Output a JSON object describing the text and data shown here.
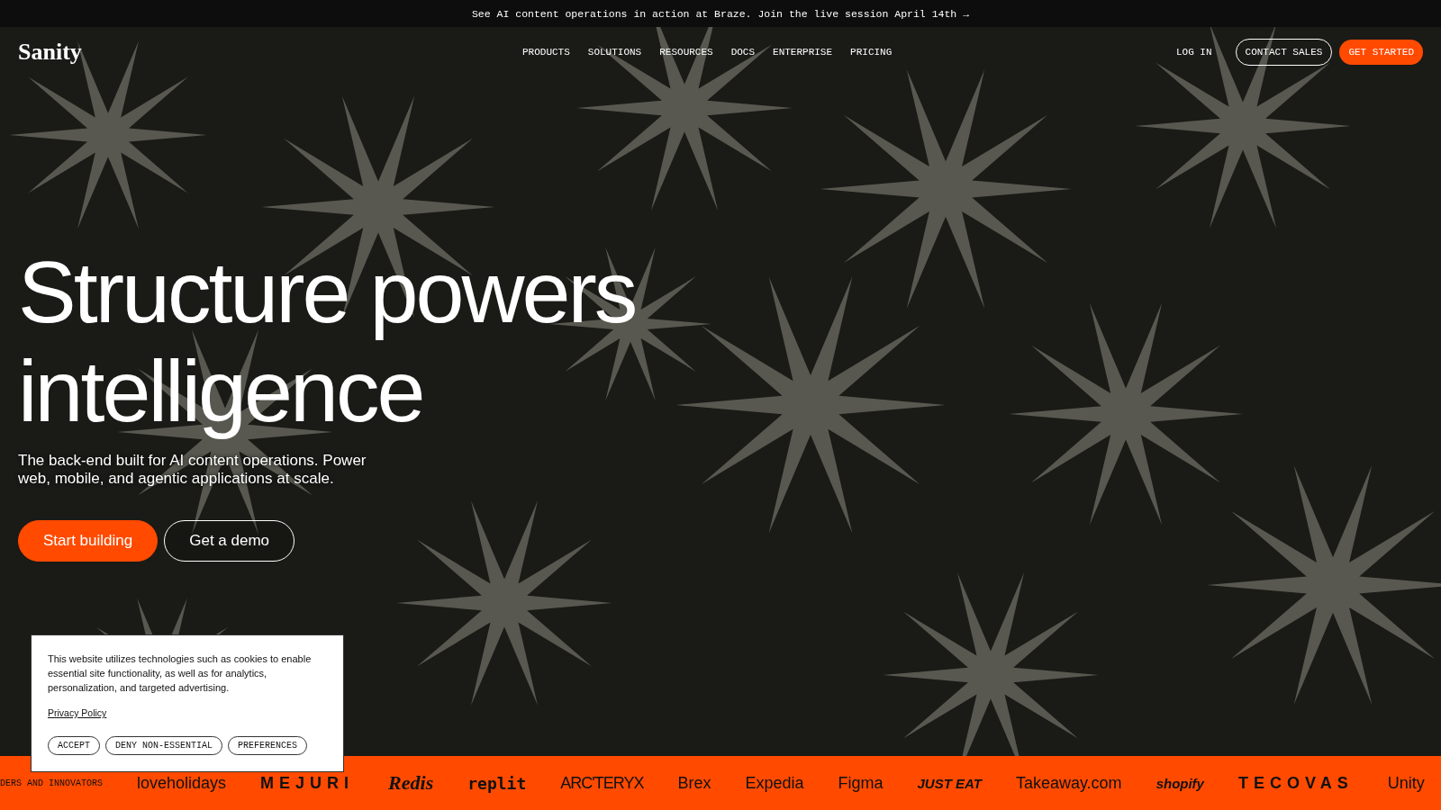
{
  "announcement": {
    "text": "See AI content operations in action at Braze. Join the live session April 14th",
    "arrow": "→"
  },
  "header": {
    "logo": "Sanity",
    "nav": [
      "PRODUCTS",
      "SOLUTIONS",
      "RESOURCES",
      "DOCS",
      "ENTERPRISE",
      "PRICING"
    ],
    "actions": [
      {
        "label": "LOG IN",
        "kind": "link"
      },
      {
        "label": "CONTACT SALES",
        "kind": "outline"
      },
      {
        "label": "GET STARTED",
        "kind": "primary"
      }
    ]
  },
  "hero": {
    "kind": "picture",
    "headline": [
      "Structure powers",
      "intelligence"
    ],
    "subtitle": "The back-end built for AI content operations. Power web, mobile, and agentic applications at scale.",
    "buttons": [
      {
        "label": "Start building",
        "kind": "primary"
      },
      {
        "label": "Get a demo",
        "kind": "outline"
      }
    ]
  },
  "logo_strip": {
    "caption": "DERS AND INNOVATORS",
    "logos": [
      "loveholidays",
      "MEJURI",
      "Redis",
      "replit",
      "ARC'TERYX",
      "Brex",
      "Expedia",
      "Figma",
      "JUST EAT",
      "Takeaway.com",
      "shopify",
      "TECOVAS",
      "Unity"
    ]
  },
  "cookie_banner": {
    "text": "This website utilizes technologies such as cookies to enable essential site functionality, as well as for analytics, personalization, and targeted advertising.",
    "link": "Privacy Policy",
    "buttons": [
      "ACCEPT",
      "DENY NON-ESSENTIAL",
      "PREFERENCES"
    ]
  }
}
